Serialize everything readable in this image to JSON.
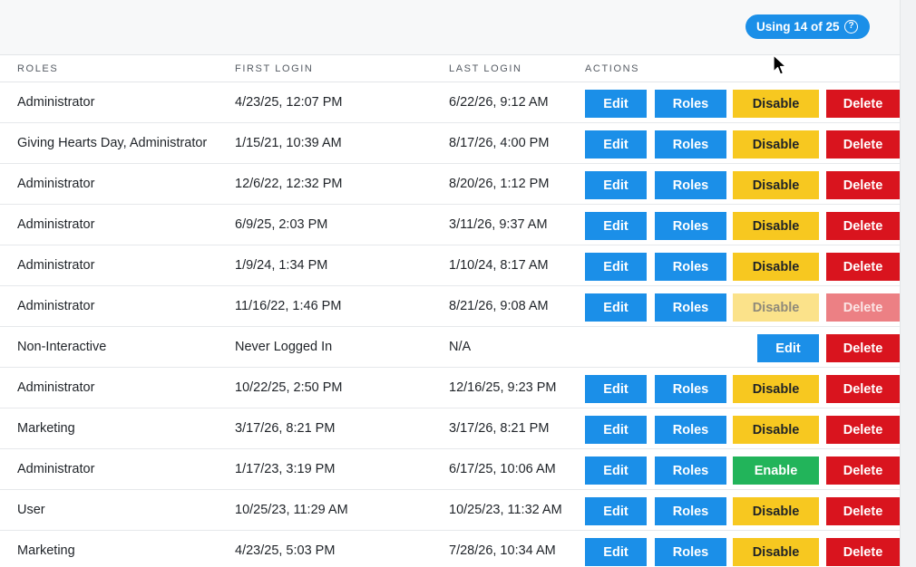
{
  "header": {
    "usage_label": "Using 14 of 25",
    "help_icon": "question-circle-icon",
    "accent_color": "#1b8fe8"
  },
  "table": {
    "columns": [
      "ROLES",
      "FIRST LOGIN",
      "LAST LOGIN",
      "ACTIONS"
    ],
    "rows": [
      {
        "roles": "Administrator",
        "first_login": "4/23/25, 12:07 PM",
        "last_login": "6/22/26, 9:12 AM",
        "actions": [
          "Edit",
          "Roles",
          "Disable",
          "Delete"
        ]
      },
      {
        "roles": "Giving Hearts Day, Administrator",
        "first_login": "1/15/21, 10:39 AM",
        "last_login": "8/17/26, 4:00 PM",
        "actions": [
          "Edit",
          "Roles",
          "Disable",
          "Delete"
        ]
      },
      {
        "roles": "Administrator",
        "first_login": "12/6/22, 12:32 PM",
        "last_login": "8/20/26, 1:12 PM",
        "actions": [
          "Edit",
          "Roles",
          "Disable",
          "Delete"
        ]
      },
      {
        "roles": "Administrator",
        "first_login": "6/9/25, 2:03 PM",
        "last_login": "3/11/26, 9:37 AM",
        "actions": [
          "Edit",
          "Roles",
          "Disable",
          "Delete"
        ]
      },
      {
        "roles": "Administrator",
        "first_login": "1/9/24, 1:34 PM",
        "last_login": "1/10/24, 8:17 AM",
        "actions": [
          "Edit",
          "Roles",
          "Disable",
          "Delete"
        ]
      },
      {
        "roles": "Administrator",
        "first_login": "11/16/22, 1:46 PM",
        "last_login": "8/21/26, 9:08 AM",
        "actions": [
          "Edit",
          "Roles",
          "Disable",
          "Delete"
        ],
        "disabled_actions": [
          "Disable",
          "Delete"
        ]
      },
      {
        "roles": "Non-Interactive",
        "first_login": "Never Logged In",
        "last_login": "N/A",
        "actions": [
          "Edit",
          "Delete"
        ]
      },
      {
        "roles": "Administrator",
        "first_login": "10/22/25, 2:50 PM",
        "last_login": "12/16/25, 9:23 PM",
        "actions": [
          "Edit",
          "Roles",
          "Disable",
          "Delete"
        ]
      },
      {
        "roles": "Marketing",
        "first_login": "3/17/26, 8:21 PM",
        "last_login": "3/17/26, 8:21 PM",
        "actions": [
          "Edit",
          "Roles",
          "Disable",
          "Delete"
        ]
      },
      {
        "roles": "Administrator",
        "first_login": "1/17/23, 3:19 PM",
        "last_login": "6/17/25, 10:06 AM",
        "actions": [
          "Edit",
          "Roles",
          "Enable",
          "Delete"
        ]
      },
      {
        "roles": "User",
        "first_login": "10/25/23, 11:29 AM",
        "last_login": "10/25/23, 11:32 AM",
        "actions": [
          "Edit",
          "Roles",
          "Disable",
          "Delete"
        ]
      },
      {
        "roles": "Marketing",
        "first_login": "4/23/25, 5:03 PM",
        "last_login": "7/28/26, 10:34 AM",
        "actions": [
          "Edit",
          "Roles",
          "Disable",
          "Delete"
        ]
      }
    ]
  },
  "colors": {
    "edit": "#1b8fe8",
    "roles": "#1b8fe8",
    "disable": "#f7c820",
    "enable": "#22b45a",
    "delete": "#d9141e"
  }
}
